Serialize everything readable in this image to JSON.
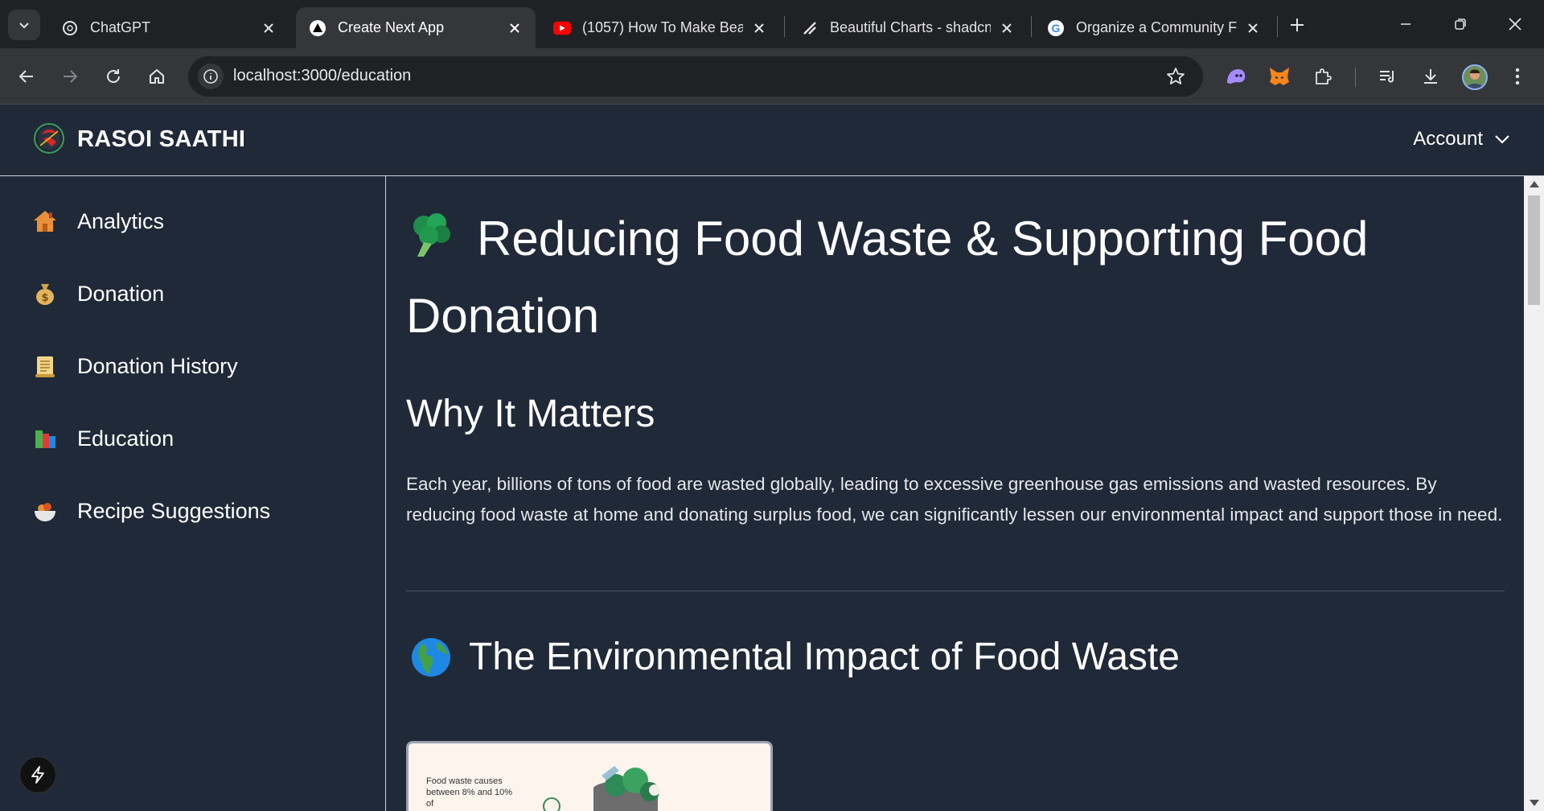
{
  "browser": {
    "tabs": [
      {
        "title": "ChatGPT",
        "icon": "chatgpt-icon"
      },
      {
        "title": "Create Next App",
        "icon": "nextjs-icon"
      },
      {
        "title": "(1057) How To Make Bea",
        "icon": "youtube-icon"
      },
      {
        "title": "Beautiful Charts - shadcn",
        "icon": "shadcn-icon"
      },
      {
        "title": "Organize a Community F",
        "icon": "google-icon"
      }
    ],
    "url": "localhost:3000/education"
  },
  "header": {
    "brand": "RASOI SAATHI",
    "account_label": "Account"
  },
  "sidebar": {
    "items": [
      {
        "label": "Analytics",
        "icon": "house-icon"
      },
      {
        "label": "Donation",
        "icon": "money-bag-icon"
      },
      {
        "label": "Donation History",
        "icon": "scroll-icon"
      },
      {
        "label": "Education",
        "icon": "books-icon"
      },
      {
        "label": "Recipe Suggestions",
        "icon": "bowl-icon"
      }
    ]
  },
  "main": {
    "title": "Reducing Food Waste & Supporting Food Donation",
    "why_heading": "Why It Matters",
    "why_text": "Each year, billions of tons of food are wasted globally, leading to excessive greenhouse gas emissions and wasted resources. By reducing food waste at home and donating surplus food, we can significantly lessen our environmental impact and support those in need.",
    "impact_heading": "The Environmental Impact of Food Waste",
    "infographic_caption": "Food waste causes between 8% and 10% of"
  },
  "colors": {
    "background": "#1f2937",
    "chrome_dark": "#202124",
    "chrome_mid": "#35363a",
    "border": "#cfd4da"
  }
}
